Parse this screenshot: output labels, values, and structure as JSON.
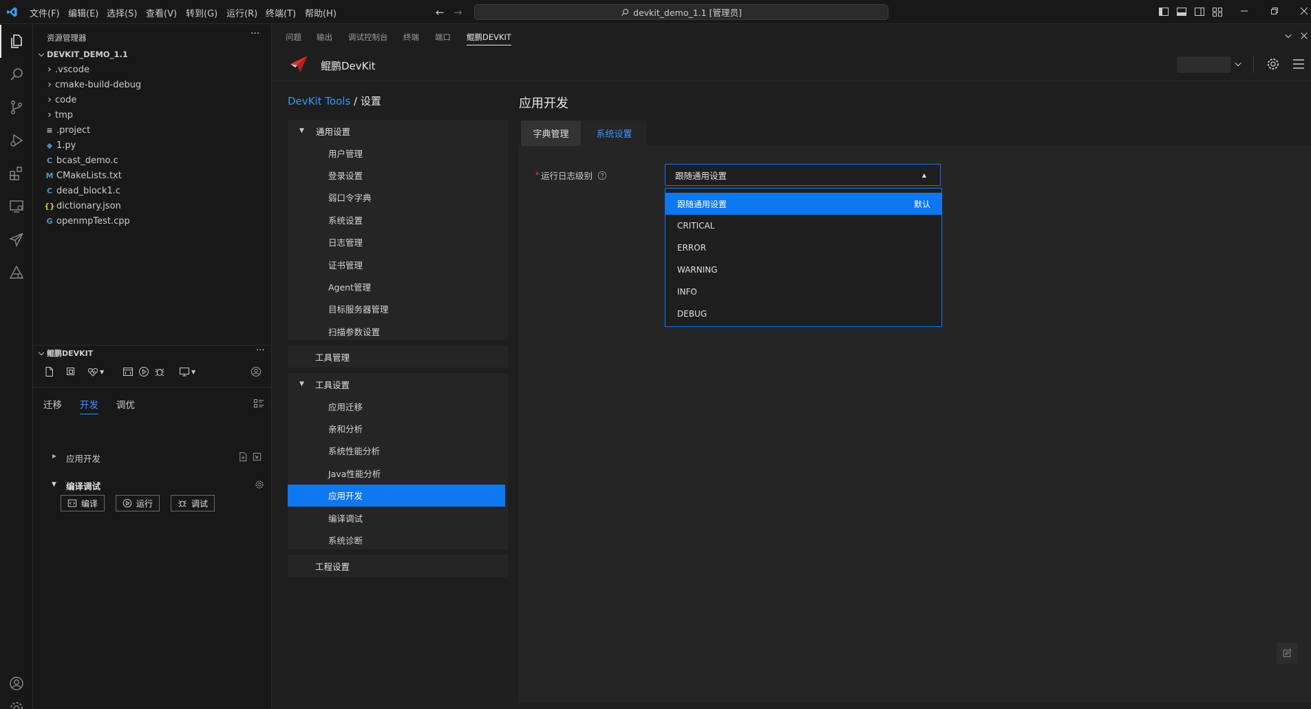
{
  "titlebar": {
    "menus": [
      "文件(F)",
      "编辑(E)",
      "选择(S)",
      "查看(V)",
      "转到(G)",
      "运行(R)",
      "终端(T)",
      "帮助(H)"
    ],
    "command_center": "devkit_demo_1.1 [管理员]"
  },
  "explorer": {
    "title": "资源管理器",
    "root": "DEVKIT_DEMO_1.1",
    "items": [
      {
        "name": ".vscode",
        "kind": "folder"
      },
      {
        "name": "cmake-build-debug",
        "kind": "folder"
      },
      {
        "name": "code",
        "kind": "folder"
      },
      {
        "name": "tmp",
        "kind": "folder"
      },
      {
        "name": ".project",
        "kind": "file",
        "icon": "≡",
        "color": "#cccccc"
      },
      {
        "name": "1.py",
        "kind": "file",
        "icon": "◆",
        "color": "#4b8bbe"
      },
      {
        "name": "bcast_demo.c",
        "kind": "file",
        "icon": "C",
        "color": "#519aba"
      },
      {
        "name": "CMakeLists.txt",
        "kind": "file",
        "icon": "M",
        "color": "#519aba"
      },
      {
        "name": "dead_block1.c",
        "kind": "file",
        "icon": "C",
        "color": "#519aba"
      },
      {
        "name": "dictionary.json",
        "kind": "file",
        "icon": "{}",
        "color": "#cbcb41"
      },
      {
        "name": "openmpTest.cpp",
        "kind": "file",
        "icon": "G",
        "color": "#519aba"
      }
    ]
  },
  "devkit_section": {
    "title": "鲲鹏DEVKIT",
    "tabs": [
      "迁移",
      "开发",
      "调优"
    ],
    "active_tab": "开发",
    "app_dev": "应用开发",
    "compile_debug": "编译调试",
    "buttons": {
      "compile": "编译",
      "run": "运行",
      "debug": "调试"
    }
  },
  "panel_tabs": [
    "问题",
    "输出",
    "调试控制台",
    "终端",
    "端口",
    "鲲鹏DEVKIT"
  ],
  "devkit_header": {
    "brand": "鲲鹏DevKit"
  },
  "breadcrumb": {
    "link": "DevKit Tools",
    "sep": " / ",
    "current": "设置"
  },
  "nav": {
    "general": "通用设置",
    "general_items": [
      "用户管理",
      "登录设置",
      "弱口令字典",
      "系统设置",
      "日志管理",
      "证书管理",
      "Agent管理",
      "目标服务器管理",
      "扫描参数设置"
    ],
    "tool_manage": "工具管理",
    "tool_settings": "工具设置",
    "tool_items": [
      "应用迁移",
      "亲和分析",
      "系统性能分析",
      "Java性能分析",
      "应用开发",
      "编译调试",
      "系统诊断"
    ],
    "active_item": "应用开发",
    "project_settings": "工程设置"
  },
  "content": {
    "title": "应用开发",
    "tabs": [
      "字典管理",
      "系统设置"
    ],
    "active_tab": "系统设置",
    "required_mark": "*",
    "field_label": "运行日志级别",
    "select_value": "跟随通用设置",
    "options": [
      {
        "label": "跟随通用设置",
        "tag": "默认",
        "selected": true
      },
      {
        "label": "CRITICAL"
      },
      {
        "label": "ERROR"
      },
      {
        "label": "WARNING"
      },
      {
        "label": "INFO"
      },
      {
        "label": "DEBUG"
      }
    ]
  },
  "colors": {
    "accent": "#0e78f0",
    "link": "#3794ff",
    "required": "#f14c4c"
  }
}
